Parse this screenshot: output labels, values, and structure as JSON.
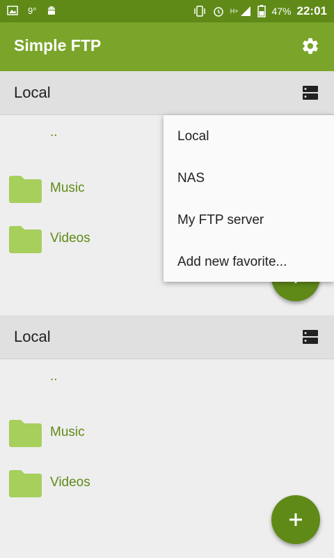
{
  "status_bar": {
    "temperature": "9°",
    "battery": "47%",
    "time": "22:01",
    "network": "H+"
  },
  "app_bar": {
    "title": "Simple FTP",
    "settings_icon": "gear-icon"
  },
  "panels": [
    {
      "header_label": "Local",
      "up_label": "..",
      "items": [
        {
          "name": "Music"
        },
        {
          "name": "Videos"
        }
      ]
    },
    {
      "header_label": "Local",
      "up_label": "..",
      "items": [
        {
          "name": "Music"
        },
        {
          "name": "Videos"
        }
      ]
    }
  ],
  "dropdown_menu": {
    "items": [
      "Local",
      "NAS",
      "My FTP server",
      "Add new favorite..."
    ]
  },
  "colors": {
    "status_bar": "#5f8a18",
    "app_bar": "#7aa52a",
    "accent": "#5f8a18",
    "folder": "#a6cf5c"
  }
}
